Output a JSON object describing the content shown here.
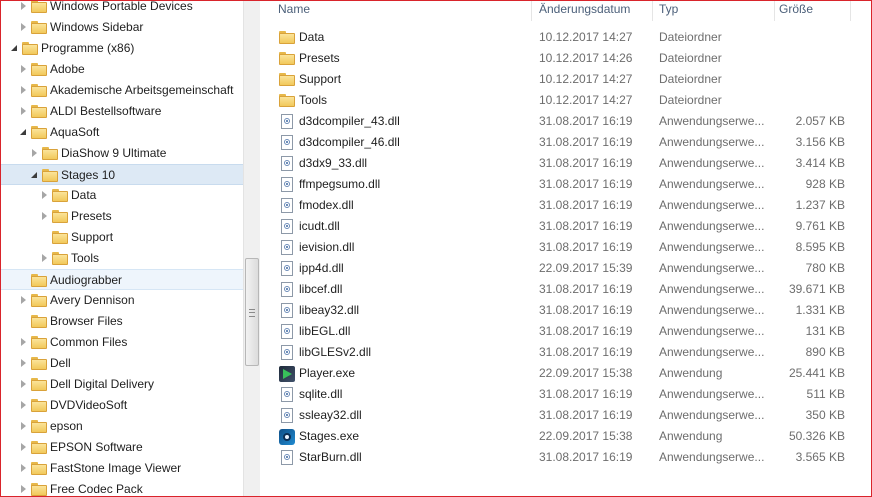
{
  "nav": {
    "items": [
      {
        "label": "Windows Portable Devices",
        "arrow": "collapsed",
        "indent": 1,
        "state": ""
      },
      {
        "label": "Windows Sidebar",
        "arrow": "collapsed",
        "indent": 1,
        "state": ""
      },
      {
        "label": "Programme (x86)",
        "arrow": "expanded",
        "indent": 0,
        "state": ""
      },
      {
        "label": "Adobe",
        "arrow": "collapsed",
        "indent": 1,
        "state": ""
      },
      {
        "label": "Akademische Arbeitsgemeinschaft",
        "arrow": "collapsed",
        "indent": 1,
        "state": ""
      },
      {
        "label": "ALDI Bestellsoftware",
        "arrow": "collapsed",
        "indent": 1,
        "state": ""
      },
      {
        "label": "AquaSoft",
        "arrow": "expanded",
        "indent": 1,
        "state": ""
      },
      {
        "label": "DiaShow 9 Ultimate",
        "arrow": "collapsed",
        "indent": 2,
        "state": ""
      },
      {
        "label": "Stages 10",
        "arrow": "expanded",
        "indent": 2,
        "state": "selected"
      },
      {
        "label": "Data",
        "arrow": "collapsed",
        "indent": 3,
        "state": ""
      },
      {
        "label": "Presets",
        "arrow": "collapsed",
        "indent": 3,
        "state": ""
      },
      {
        "label": "Support",
        "arrow": "none",
        "indent": 3,
        "state": ""
      },
      {
        "label": "Tools",
        "arrow": "collapsed",
        "indent": 3,
        "state": ""
      },
      {
        "label": "Audiograbber",
        "arrow": "none",
        "indent": 1,
        "state": "hover"
      },
      {
        "label": "Avery Dennison",
        "arrow": "collapsed",
        "indent": 1,
        "state": ""
      },
      {
        "label": "Browser Files",
        "arrow": "none",
        "indent": 1,
        "state": ""
      },
      {
        "label": "Common Files",
        "arrow": "collapsed",
        "indent": 1,
        "state": ""
      },
      {
        "label": "Dell",
        "arrow": "collapsed",
        "indent": 1,
        "state": ""
      },
      {
        "label": "Dell Digital Delivery",
        "arrow": "collapsed",
        "indent": 1,
        "state": ""
      },
      {
        "label": "DVDVideoSoft",
        "arrow": "collapsed",
        "indent": 1,
        "state": ""
      },
      {
        "label": "epson",
        "arrow": "collapsed",
        "indent": 1,
        "state": ""
      },
      {
        "label": "EPSON Software",
        "arrow": "collapsed",
        "indent": 1,
        "state": ""
      },
      {
        "label": "FastStone Image Viewer",
        "arrow": "collapsed",
        "indent": 1,
        "state": ""
      },
      {
        "label": "Free Codec Pack",
        "arrow": "collapsed",
        "indent": 1,
        "state": ""
      }
    ]
  },
  "columns": {
    "name": "Name",
    "date": "Änderungsdatum",
    "type": "Typ",
    "size": "Größe"
  },
  "files": [
    {
      "name": "Data",
      "date": "10.12.2017 14:27",
      "type": "Dateiordner",
      "size": "",
      "icon": "folder"
    },
    {
      "name": "Presets",
      "date": "10.12.2017 14:26",
      "type": "Dateiordner",
      "size": "",
      "icon": "folder"
    },
    {
      "name": "Support",
      "date": "10.12.2017 14:27",
      "type": "Dateiordner",
      "size": "",
      "icon": "folder"
    },
    {
      "name": "Tools",
      "date": "10.12.2017 14:27",
      "type": "Dateiordner",
      "size": "",
      "icon": "folder"
    },
    {
      "name": "d3dcompiler_43.dll",
      "date": "31.08.2017 16:19",
      "type": "Anwendungserwe...",
      "size": "2.057 KB",
      "icon": "dll"
    },
    {
      "name": "d3dcompiler_46.dll",
      "date": "31.08.2017 16:19",
      "type": "Anwendungserwe...",
      "size": "3.156 KB",
      "icon": "dll"
    },
    {
      "name": "d3dx9_33.dll",
      "date": "31.08.2017 16:19",
      "type": "Anwendungserwe...",
      "size": "3.414 KB",
      "icon": "dll"
    },
    {
      "name": "ffmpegsumo.dll",
      "date": "31.08.2017 16:19",
      "type": "Anwendungserwe...",
      "size": "928 KB",
      "icon": "dll"
    },
    {
      "name": "fmodex.dll",
      "date": "31.08.2017 16:19",
      "type": "Anwendungserwe...",
      "size": "1.237 KB",
      "icon": "dll"
    },
    {
      "name": "icudt.dll",
      "date": "31.08.2017 16:19",
      "type": "Anwendungserwe...",
      "size": "9.761 KB",
      "icon": "dll"
    },
    {
      "name": "ievision.dll",
      "date": "31.08.2017 16:19",
      "type": "Anwendungserwe...",
      "size": "8.595 KB",
      "icon": "dll"
    },
    {
      "name": "ipp4d.dll",
      "date": "22.09.2017 15:39",
      "type": "Anwendungserwe...",
      "size": "780 KB",
      "icon": "dll"
    },
    {
      "name": "libcef.dll",
      "date": "31.08.2017 16:19",
      "type": "Anwendungserwe...",
      "size": "39.671 KB",
      "icon": "dll"
    },
    {
      "name": "libeay32.dll",
      "date": "31.08.2017 16:19",
      "type": "Anwendungserwe...",
      "size": "1.331 KB",
      "icon": "dll"
    },
    {
      "name": "libEGL.dll",
      "date": "31.08.2017 16:19",
      "type": "Anwendungserwe...",
      "size": "131 KB",
      "icon": "dll"
    },
    {
      "name": "libGLESv2.dll",
      "date": "31.08.2017 16:19",
      "type": "Anwendungserwe...",
      "size": "890 KB",
      "icon": "dll"
    },
    {
      "name": "Player.exe",
      "date": "22.09.2017 15:38",
      "type": "Anwendung",
      "size": "25.441 KB",
      "icon": "player-exe"
    },
    {
      "name": "sqlite.dll",
      "date": "31.08.2017 16:19",
      "type": "Anwendungserwe...",
      "size": "511 KB",
      "icon": "dll"
    },
    {
      "name": "ssleay32.dll",
      "date": "31.08.2017 16:19",
      "type": "Anwendungserwe...",
      "size": "350 KB",
      "icon": "dll"
    },
    {
      "name": "Stages.exe",
      "date": "22.09.2017 15:38",
      "type": "Anwendung",
      "size": "50.326 KB",
      "icon": "stages-exe"
    },
    {
      "name": "StarBurn.dll",
      "date": "31.08.2017 16:19",
      "type": "Anwendungserwe...",
      "size": "3.565 KB",
      "icon": "dll"
    }
  ]
}
